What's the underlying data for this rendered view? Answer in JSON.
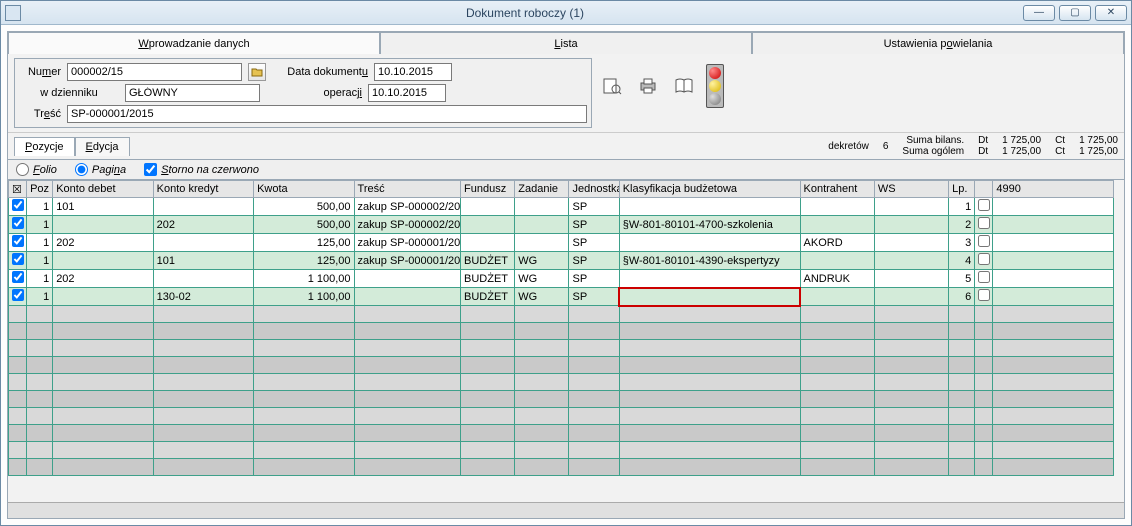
{
  "window": {
    "title": "Dokument roboczy (1)"
  },
  "tabs": [
    {
      "label_pre": "",
      "u": "W",
      "label_post": "prowadzanie danych"
    },
    {
      "label_pre": "",
      "u": "L",
      "label_post": "ista"
    },
    {
      "label_pre": "Ustawienia p",
      "u": "o",
      "label_post": "wielania"
    }
  ],
  "form": {
    "numer_label_pre": "Nu",
    "numer_label_u": "m",
    "numer_label_post": "er",
    "numer": "000002/15",
    "dziennik_label": "w dzienniku",
    "dziennik": "GŁÓWNY",
    "datadok_label_pre": "Data dokument",
    "datadok_label_u": "u",
    "datadok": "10.10.2015",
    "operacji_label_pre": "operacj",
    "operacji_label_u": "i",
    "operacji": "10.10.2015",
    "tresc_label_pre": "Tr",
    "tresc_label_u": "e",
    "tresc_label_post": "ść",
    "tresc": "SP-000001/2015"
  },
  "subtabs": {
    "pozycje_u": "P",
    "pozycje_post": "ozycje",
    "edycja_u": "E",
    "edycja_post": "dycja"
  },
  "summary": {
    "dekretow_label": "dekretów",
    "dekretow_value": "6",
    "bilans_label": "Suma bilans.",
    "ogolem_label": "Suma ogólem",
    "dt_label": "Dt",
    "ct_label": "Ct",
    "dt1": "1 725,00",
    "ct1": "1 725,00",
    "dt2": "1 725,00",
    "ct2": "1 725,00"
  },
  "options": {
    "folio_u": "F",
    "folio_post": "olio",
    "pagina_pre": "Pagi",
    "pagina_u": "n",
    "pagina_post": "a",
    "storno_u": "S",
    "storno_post": "torno na czerwono"
  },
  "grid": {
    "headers": {
      "poz": "Poz",
      "debet": "Konto debet",
      "kredyt": "Konto kredyt",
      "kwota": "Kwota",
      "tresc": "Treść",
      "fundusz": "Fundusz",
      "zadanie": "Zadanie",
      "jednostka": "Jednostka",
      "klasyf": "Klasyfikacja budżetowa",
      "kontrahent": "Kontrahent",
      "ws": "WS",
      "lp": "Lp.",
      "c4990": "4990"
    },
    "rows": [
      {
        "chk": true,
        "poz": "1",
        "deb": "101",
        "kre": "",
        "kw": "500,00",
        "tr": "zakup  SP-000002/20",
        "fu": "",
        "za": "",
        "je": "SP",
        "kl": "",
        "ko": "",
        "ws": "",
        "lp": "1"
      },
      {
        "chk": true,
        "poz": "1",
        "deb": "",
        "kre": "202",
        "kw": "500,00",
        "tr": "zakup  SP-000002/20",
        "fu": "",
        "za": "",
        "je": "SP",
        "kl": "§W-801-80101-4700-szkolenia",
        "ko": "",
        "ws": "",
        "lp": "2"
      },
      {
        "chk": true,
        "poz": "1",
        "deb": "202",
        "kre": "",
        "kw": "125,00",
        "tr": "zakup  SP-000001/20",
        "fu": "",
        "za": "",
        "je": "SP",
        "kl": "",
        "ko": "AKORD",
        "ws": "",
        "lp": "3"
      },
      {
        "chk": true,
        "poz": "1",
        "deb": "",
        "kre": "101",
        "kw": "125,00",
        "tr": "zakup  SP-000001/20",
        "fu": "BUDŻET",
        "za": "WG",
        "je": "SP",
        "kl": "§W-801-80101-4390-ekspertyzy",
        "ko": "",
        "ws": "",
        "lp": "4"
      },
      {
        "chk": true,
        "poz": "1",
        "deb": "202",
        "kre": "",
        "kw": "1 100,00",
        "tr": "",
        "fu": "BUDŻET",
        "za": "WG",
        "je": "SP",
        "kl": "",
        "ko": "ANDRUK",
        "ws": "",
        "lp": "5"
      },
      {
        "chk": true,
        "poz": "1",
        "deb": "",
        "kre": "130-02",
        "kw": "1 100,00",
        "tr": "",
        "fu": "BUDŻET",
        "za": "WG",
        "je": "SP",
        "kl": "",
        "ko": "",
        "ws": "",
        "lp": "6"
      }
    ]
  }
}
